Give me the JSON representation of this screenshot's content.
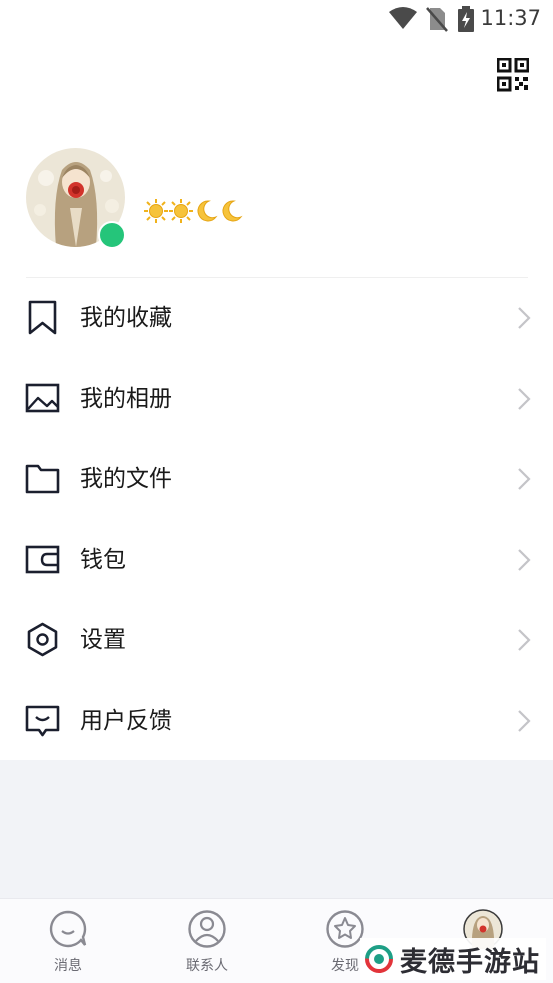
{
  "status_bar": {
    "time": "11:37",
    "icons": [
      "wifi-icon",
      "no-sim-icon",
      "battery-charging-icon"
    ]
  },
  "header": {
    "qr_icon": "qr-code-icon"
  },
  "profile": {
    "avatar": "avatar-image",
    "status_color": "#25c57a",
    "level_icons": [
      "sun-icon",
      "sun-icon",
      "moon-icon",
      "moon-icon"
    ]
  },
  "menu": {
    "items": [
      {
        "label": "我的收藏",
        "icon": "bookmark-icon"
      },
      {
        "label": "我的相册",
        "icon": "image-icon"
      },
      {
        "label": "我的文件",
        "icon": "folder-icon"
      },
      {
        "label": "钱包",
        "icon": "wallet-icon"
      },
      {
        "label": "设置",
        "icon": "hexagon-settings-icon"
      },
      {
        "label": "用户反馈",
        "icon": "feedback-icon"
      }
    ]
  },
  "bottom_nav": {
    "tabs": [
      {
        "label": "消息",
        "icon": "chat-bubble-icon"
      },
      {
        "label": "联系人",
        "icon": "contact-icon"
      },
      {
        "label": "发现",
        "icon": "star-icon"
      },
      {
        "label": "",
        "icon": "avatar-tab-icon"
      }
    ]
  },
  "watermark": {
    "text": "麦德手游站"
  },
  "colors": {
    "online": "#25c57a",
    "background_gray": "#f2f3f7",
    "icon_dark": "#1b1f2e",
    "chevron": "#c4c4c8"
  }
}
